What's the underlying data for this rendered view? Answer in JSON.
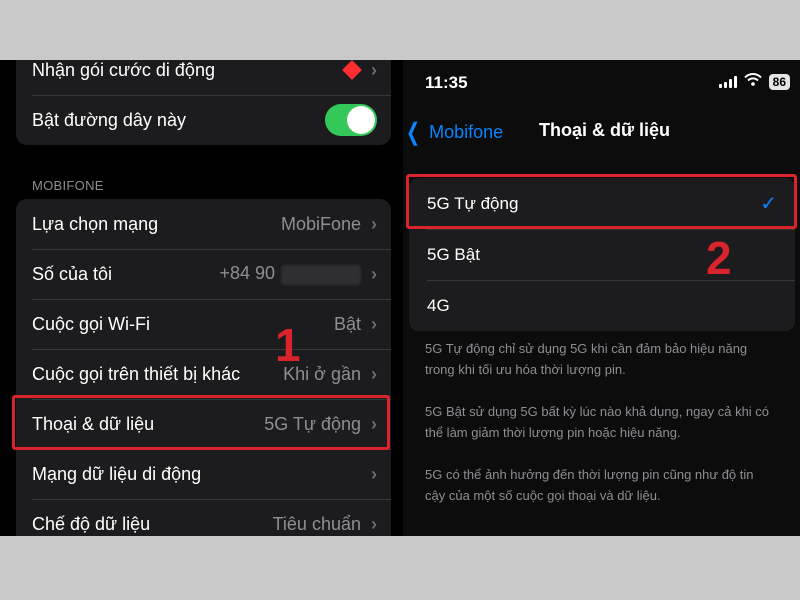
{
  "left": {
    "top_rows": [
      {
        "label": "Nhận gói cước di động"
      },
      {
        "label": "Bật đường dây này"
      }
    ],
    "section_header": "MOBIFONE",
    "rows": [
      {
        "label": "Lựa chọn mạng",
        "value": "MobiFone"
      },
      {
        "label": "Số của tôi",
        "value": "+84 90"
      },
      {
        "label": "Cuộc gọi Wi-Fi",
        "value": "Bật"
      },
      {
        "label": "Cuộc gọi trên thiết bị khác",
        "value": "Khi ở gần"
      },
      {
        "label": "Thoại & dữ liệu",
        "value": "5G Tự động"
      },
      {
        "label": "Mạng dữ liệu di động",
        "value": ""
      },
      {
        "label": "Chế độ dữ liệu",
        "value": "Tiêu chuẩn"
      }
    ],
    "step_number": "1"
  },
  "right": {
    "status": {
      "time": "11:35",
      "battery": "86"
    },
    "nav": {
      "back_label": "Mobifone",
      "title": "Thoại & dữ liệu"
    },
    "options": [
      {
        "label": "5G Tự động",
        "selected": true
      },
      {
        "label": "5G Bật",
        "selected": false
      },
      {
        "label": "4G",
        "selected": false
      }
    ],
    "footnotes": [
      "5G Tự động chỉ sử dụng 5G khi cần đảm bảo hiệu năng trong khi tối ưu hóa thời lượng pin.",
      "5G Bật sử dụng 5G bất kỳ lúc nào khả dụng, ngay cả khi có thể làm giảm thời lượng pin hoặc hiệu năng.",
      "5G có thể ảnh hưởng đến thời lượng pin cũng như độ tin cậy của một số cuộc gọi thoại và dữ liệu."
    ],
    "step_number": "2"
  },
  "colors": {
    "highlight": "#d9232d",
    "accent": "#0a84ff",
    "toggle_on": "#34c759"
  },
  "icons": [
    "chevron-right-icon",
    "back-chevron-icon",
    "checkmark-icon",
    "signal-icon",
    "wifi-icon",
    "battery-icon"
  ]
}
